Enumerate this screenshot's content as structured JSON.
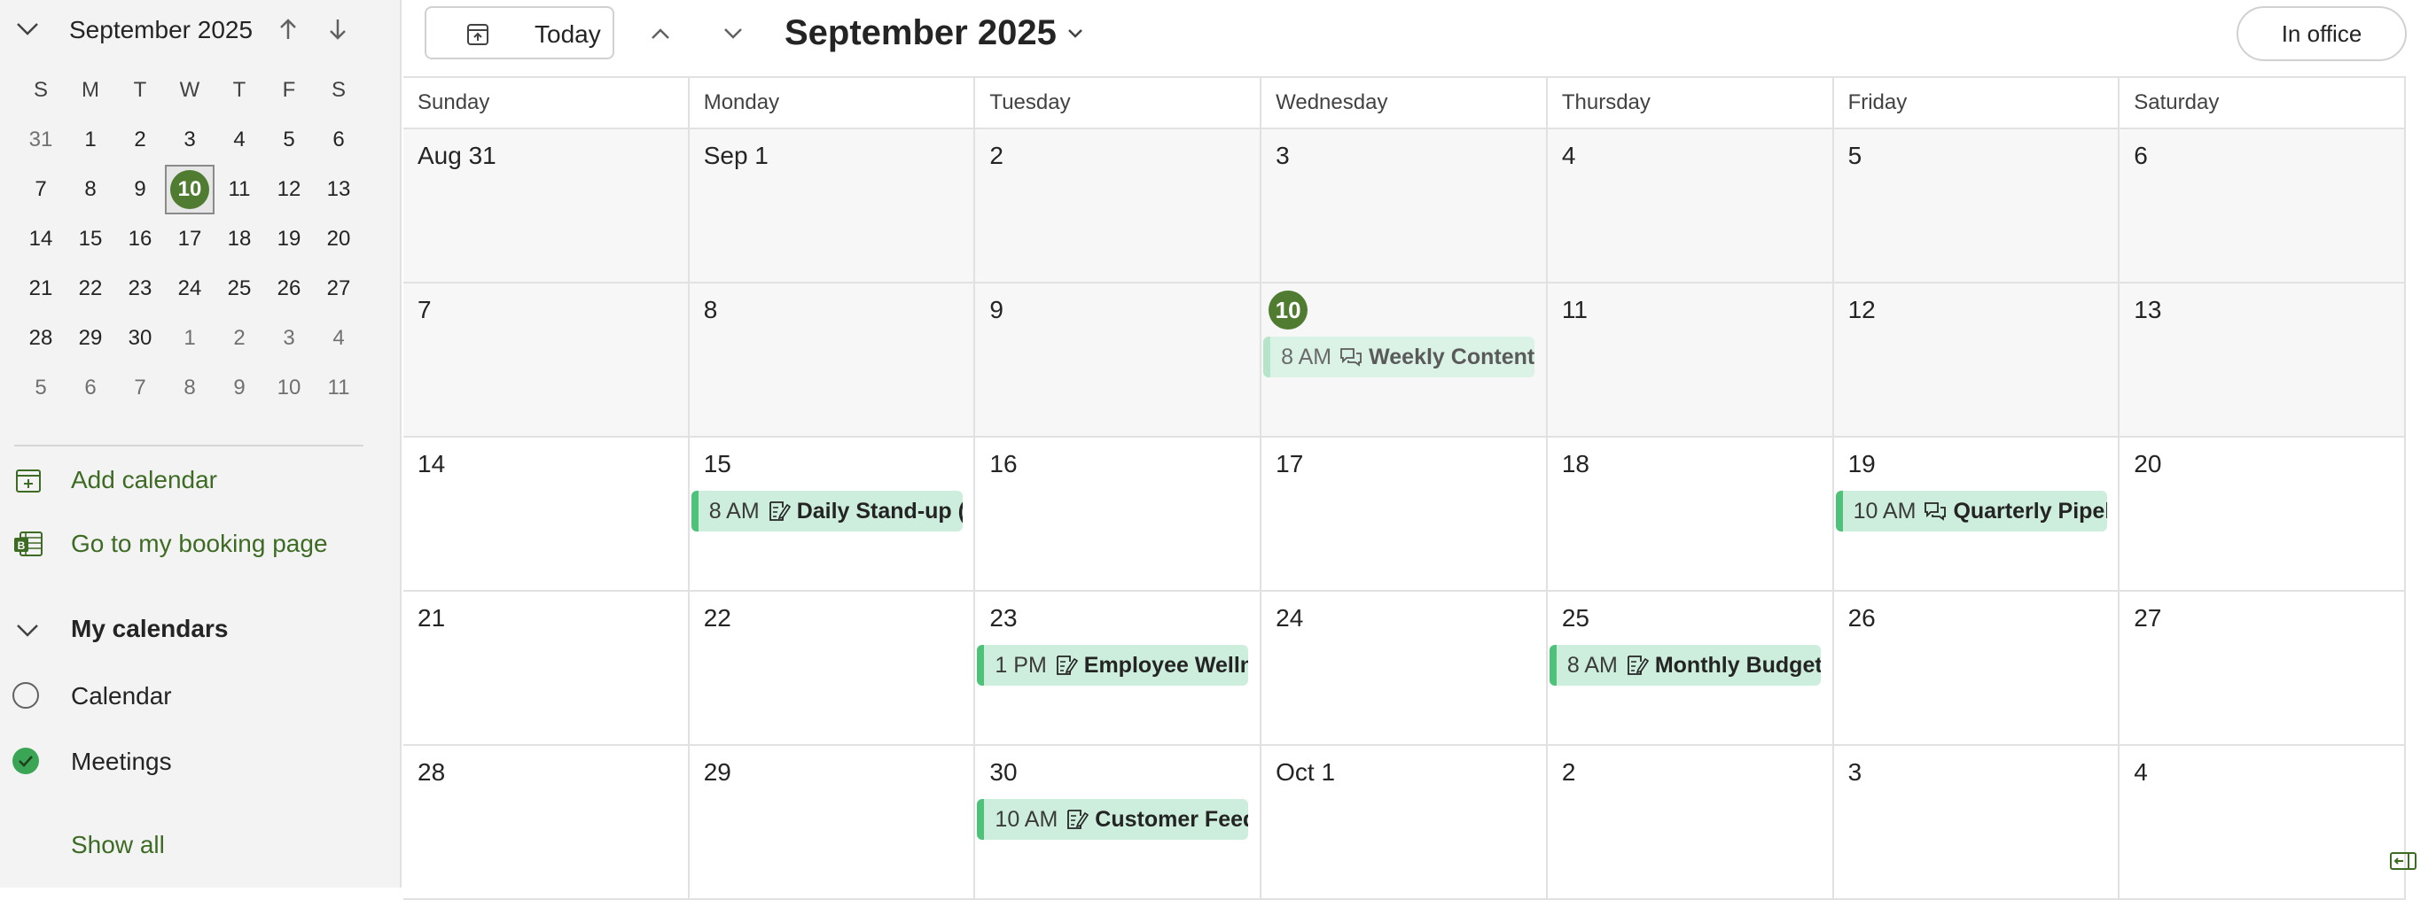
{
  "sidebar": {
    "mini_month": "September 2025",
    "weekdays": [
      "S",
      "M",
      "T",
      "W",
      "T",
      "F",
      "S"
    ],
    "weeks": [
      [
        "31",
        "1",
        "2",
        "3",
        "4",
        "5",
        "6"
      ],
      [
        "7",
        "8",
        "9",
        "10",
        "11",
        "12",
        "13"
      ],
      [
        "14",
        "15",
        "16",
        "17",
        "18",
        "19",
        "20"
      ],
      [
        "21",
        "22",
        "23",
        "24",
        "25",
        "26",
        "27"
      ],
      [
        "28",
        "29",
        "30",
        "1",
        "2",
        "3",
        "4"
      ],
      [
        "5",
        "6",
        "7",
        "8",
        "9",
        "10",
        "11"
      ]
    ],
    "add_calendar": "Add calendar",
    "booking_page": "Go to my booking page",
    "my_calendars": "My calendars",
    "calendars": [
      "Calendar",
      "Meetings"
    ],
    "show_all": "Show all"
  },
  "toolbar": {
    "today_label": "Today",
    "title": "September 2025",
    "status_label": "In office"
  },
  "grid": {
    "weekdays": [
      "Sunday",
      "Monday",
      "Tuesday",
      "Wednesday",
      "Thursday",
      "Friday",
      "Saturday"
    ],
    "weeks": [
      [
        "Aug 31",
        "Sep 1",
        "2",
        "3",
        "4",
        "5",
        "6"
      ],
      [
        "7",
        "8",
        "9",
        "10",
        "11",
        "12",
        "13"
      ],
      [
        "14",
        "15",
        "16",
        "17",
        "18",
        "19",
        "20"
      ],
      [
        "21",
        "22",
        "23",
        "24",
        "25",
        "26",
        "27"
      ],
      [
        "28",
        "29",
        "30",
        "Oct 1",
        "2",
        "3",
        "4"
      ]
    ]
  },
  "events": [
    {
      "time": "8 AM",
      "title": "Weekly Content",
      "icon": "chat-icon",
      "style": "light"
    },
    {
      "time": "8 AM",
      "title": "Daily Stand-up (S",
      "icon": "note-icon",
      "style": "normal"
    },
    {
      "time": "10 AM",
      "title": "Quarterly Pipeli",
      "icon": "chat-icon",
      "style": "normal"
    },
    {
      "time": "1 PM",
      "title": "Employee Wellne",
      "icon": "note-icon",
      "style": "normal"
    },
    {
      "time": "8 AM",
      "title": "Monthly Budget",
      "icon": "note-icon",
      "style": "normal"
    },
    {
      "time": "10 AM",
      "title": "Customer Feedl",
      "icon": "note-icon",
      "style": "normal"
    }
  ],
  "colors": {
    "accent": "#4f7c31",
    "event_bg": "#cdeedc",
    "event_bar": "#4fc27a",
    "link": "#3e6b24"
  }
}
